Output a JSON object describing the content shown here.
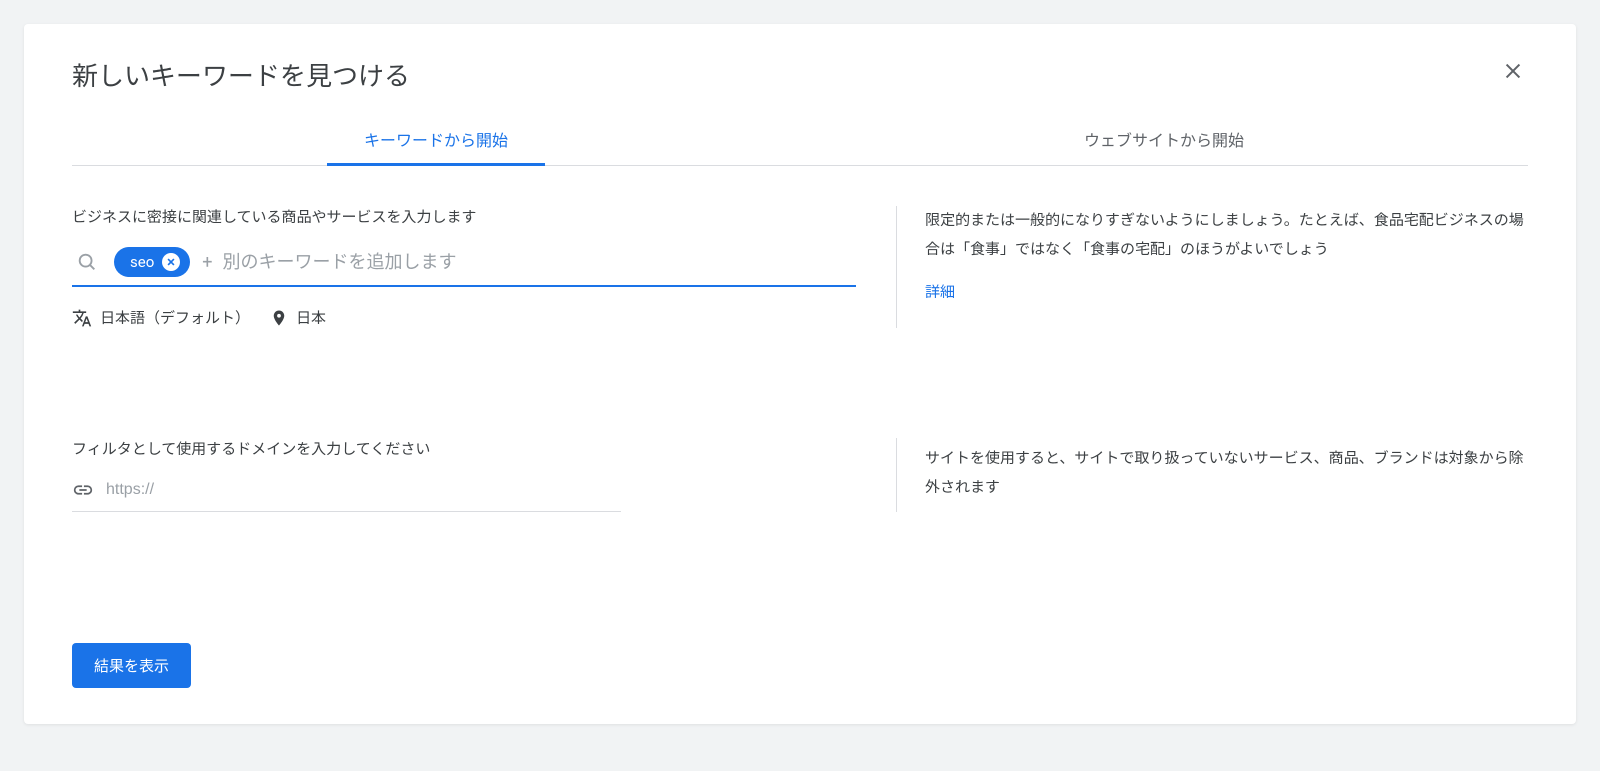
{
  "header": {
    "title": "新しいキーワードを見つける"
  },
  "tabs": {
    "active": "キーワードから開始",
    "inactive": "ウェブサイトから開始"
  },
  "keywords": {
    "section_label": "ビジネスに密接に関連している商品やサービスを入力します",
    "chip_label": "seo",
    "input_placeholder": "別のキーワードを追加します",
    "plus_prefix": "+"
  },
  "locale": {
    "language": "日本語（デフォルト）",
    "location": "日本"
  },
  "help1": {
    "text": "限定的または一般的になりすぎないようにしましょう。たとえば、食品宅配ビジネスの場合は「食事」ではなく「食事の宅配」のほうがよいでしょう",
    "learn_more": "詳細"
  },
  "domain": {
    "section_label": "フィルタとして使用するドメインを入力してください",
    "placeholder": "https://"
  },
  "help2": {
    "text": "サイトを使用すると、サイトで取り扱っていないサービス、商品、ブランドは対象から除外されます"
  },
  "footer": {
    "submit_label": "結果を表示"
  }
}
